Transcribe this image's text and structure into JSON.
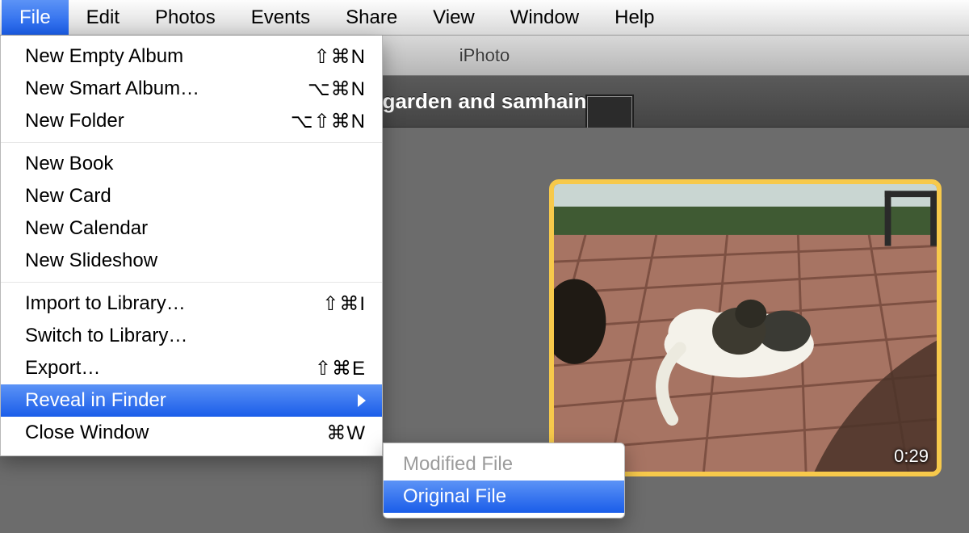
{
  "menubar": {
    "items": [
      {
        "label": "File",
        "active": true
      },
      {
        "label": "Edit",
        "active": false
      },
      {
        "label": "Photos",
        "active": false
      },
      {
        "label": "Events",
        "active": false
      },
      {
        "label": "Share",
        "active": false
      },
      {
        "label": "View",
        "active": false
      },
      {
        "label": "Window",
        "active": false
      },
      {
        "label": "Help",
        "active": false
      }
    ]
  },
  "window": {
    "title": "iPhoto",
    "subtitle": "garden and samhain"
  },
  "thumbnail": {
    "duration": "0:29"
  },
  "file_menu": {
    "groups": [
      [
        {
          "label": "New Empty Album",
          "shortcut": "⇧⌘N"
        },
        {
          "label": "New Smart Album…",
          "shortcut": "⌥⌘N"
        },
        {
          "label": "New Folder",
          "shortcut": "⌥⇧⌘N"
        }
      ],
      [
        {
          "label": "New Book",
          "shortcut": ""
        },
        {
          "label": "New Card",
          "shortcut": ""
        },
        {
          "label": "New Calendar",
          "shortcut": ""
        },
        {
          "label": "New Slideshow",
          "shortcut": ""
        }
      ],
      [
        {
          "label": "Import to Library…",
          "shortcut": "⇧⌘I"
        },
        {
          "label": "Switch to Library…",
          "shortcut": ""
        },
        {
          "label": "Export…",
          "shortcut": "⇧⌘E"
        },
        {
          "label": "Reveal in Finder",
          "shortcut": "",
          "submenu": true,
          "highlight": true
        },
        {
          "label": "Close Window",
          "shortcut": "⌘W"
        }
      ]
    ]
  },
  "reveal_submenu": {
    "items": [
      {
        "label": "Modified File",
        "disabled": true,
        "highlight": false
      },
      {
        "label": "Original File",
        "disabled": false,
        "highlight": true
      }
    ]
  }
}
